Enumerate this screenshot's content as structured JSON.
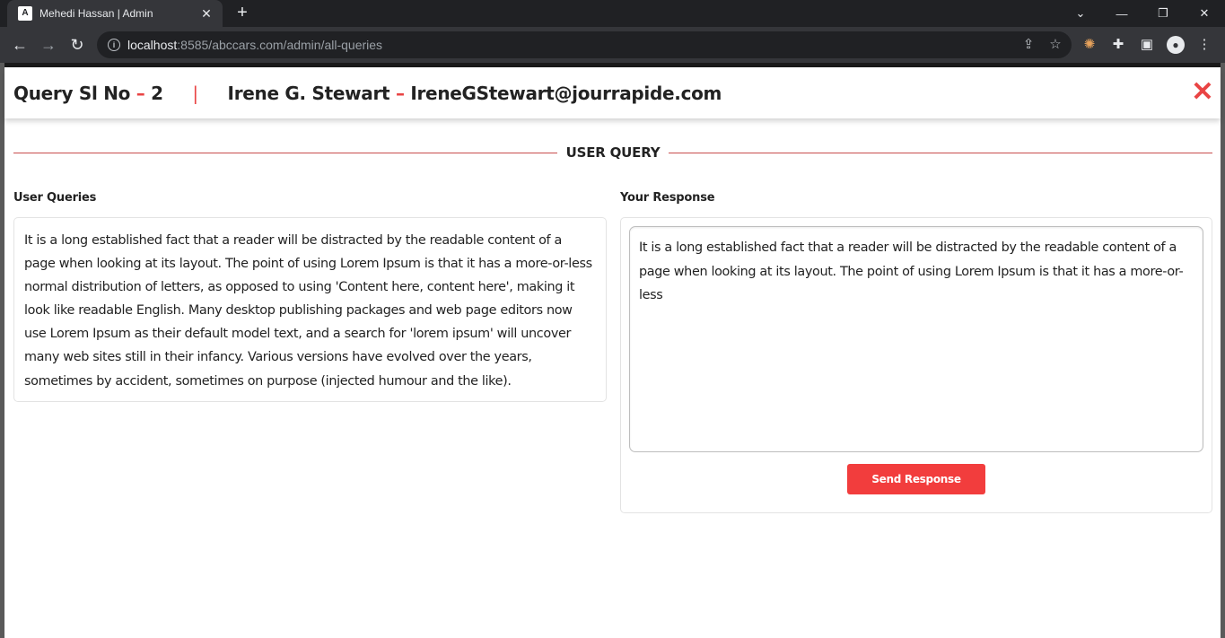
{
  "browser": {
    "tab_title": "Mehedi Hassan | Admin",
    "tab_favicon": "A",
    "url_host": "localhost",
    "url_path": ":8585/abccars.com/admin/all-queries"
  },
  "modal": {
    "query_label": "Query Sl No",
    "dash": "–",
    "query_no": "2",
    "separator": "|",
    "user_name": "Irene G. Stewart",
    "user_email": "IreneGStewart@jourrapide.com"
  },
  "section": {
    "title": "USER QUERY"
  },
  "queries": {
    "label": "User Queries",
    "text": "It is a long established fact that a reader will be distracted by the readable content of a page when looking at its layout. The point of using Lorem Ipsum is that it has a more-or-less normal distribution of letters, as opposed to using 'Content here, content here', making it look like readable English. Many desktop publishing packages and web page editors now use Lorem Ipsum as their default model text, and a search for 'lorem ipsum' will uncover many web sites still in their infancy. Various versions have evolved over the years, sometimes by accident, sometimes on purpose (injected humour and the like)."
  },
  "response": {
    "label": "Your Response",
    "value": "It is a long established fact that a reader will be distracted by the readable content of a page when looking at its layout. The point of using Lorem Ipsum is that it has a more-or-less",
    "send_label": "Send Response"
  },
  "colors": {
    "accent": "#f23d3d",
    "divider": "#c84d4d"
  },
  "icons": [
    "close-icon",
    "back-icon",
    "forward-icon",
    "reload-icon",
    "info-icon",
    "share-icon",
    "star-icon",
    "cookie-icon",
    "puzzle-icon",
    "sidepanel-icon",
    "profile-icon",
    "menu-icon"
  ]
}
